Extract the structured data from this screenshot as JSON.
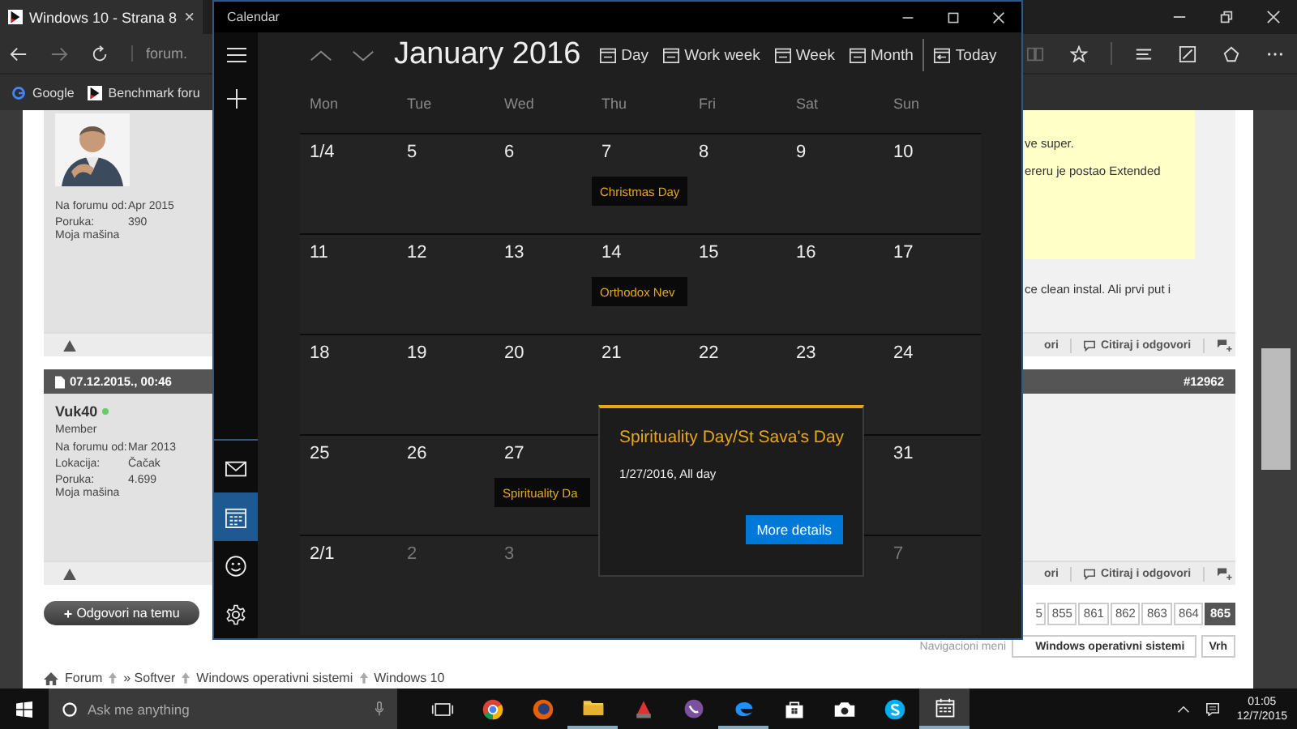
{
  "browser": {
    "tab_title": "Windows 10 - Strana 8",
    "tab_close": "×",
    "address": "forum.",
    "favorites": [
      {
        "kind": "google",
        "label": "Google"
      },
      {
        "kind": "site",
        "label": "Benchmark foru"
      }
    ]
  },
  "forum": {
    "post1": {
      "stats": [
        {
          "label": "Na forumu od:",
          "value": "Apr 2015"
        },
        {
          "label": "Poruka:",
          "value": "390"
        }
      ],
      "machine": "Moja mašina",
      "quote_lines": [
        "ve super.",
        "ereru je postao Extended"
      ],
      "text": "ce clean instal. Ali prvi put i",
      "actions": [
        "ori",
        "Citiraj i odgovori"
      ]
    },
    "post2": {
      "date": "07.12.2015., 00:46",
      "number": "#12962",
      "user": "Vuk40",
      "online": true,
      "rank": "Member",
      "stats": [
        {
          "label": "Na forumu od:",
          "value": "Mar 2013"
        },
        {
          "label": "Lokacija:",
          "value": "Čačak"
        },
        {
          "label": "Poruka:",
          "value": "4.699"
        }
      ],
      "machine": "Moja mašina",
      "actions": [
        "ori",
        "Citiraj i odgovori"
      ]
    },
    "reply_button": "Odgovori na temu",
    "pages": [
      {
        "label": "5",
        "selected": false
      },
      {
        "label": "855",
        "selected": false
      },
      {
        "label": "861",
        "selected": false
      },
      {
        "label": "862",
        "selected": false
      },
      {
        "label": "863",
        "selected": false
      },
      {
        "label": "864",
        "selected": false
      },
      {
        "label": "865",
        "selected": true
      }
    ],
    "nav_label": "Navigacioni meni",
    "nav_select": "Windows operativni sistemi",
    "top_button": "Vrh",
    "breadcrumbs": [
      "Forum",
      "» Softver",
      "Windows operativni sistemi",
      "Windows 10"
    ]
  },
  "calendar": {
    "title": "Calendar",
    "month": "January 2016",
    "views": [
      "Day",
      "Work week",
      "Week",
      "Month"
    ],
    "today": "Today",
    "rail": [
      {
        "kind": "mail",
        "selected": false
      },
      {
        "kind": "calendar",
        "selected": true
      },
      {
        "kind": "smiley",
        "selected": false
      },
      {
        "kind": "gear",
        "selected": false
      }
    ],
    "weekdays": [
      "Mon",
      "Tue",
      "Wed",
      "Thu",
      "Fri",
      "Sat",
      "Sun"
    ],
    "weeks": [
      [
        {
          "day": "1/4",
          "muted": false
        },
        {
          "day": "5",
          "muted": false
        },
        {
          "day": "6",
          "muted": false
        },
        {
          "day": "7",
          "muted": false,
          "event": "Christmas Day"
        },
        {
          "day": "8",
          "muted": false
        },
        {
          "day": "9",
          "muted": false
        },
        {
          "day": "10",
          "muted": false
        }
      ],
      [
        {
          "day": "11",
          "muted": false
        },
        {
          "day": "12",
          "muted": false
        },
        {
          "day": "13",
          "muted": false
        },
        {
          "day": "14",
          "muted": false,
          "event": "Orthodox Nev"
        },
        {
          "day": "15",
          "muted": false
        },
        {
          "day": "16",
          "muted": false
        },
        {
          "day": "17",
          "muted": false
        }
      ],
      [
        {
          "day": "18",
          "muted": false
        },
        {
          "day": "19",
          "muted": false
        },
        {
          "day": "20",
          "muted": false
        },
        {
          "day": "21",
          "muted": false
        },
        {
          "day": "22",
          "muted": false
        },
        {
          "day": "23",
          "muted": false
        },
        {
          "day": "24",
          "muted": false
        }
      ],
      [
        {
          "day": "25",
          "muted": false
        },
        {
          "day": "26",
          "muted": false
        },
        {
          "day": "27",
          "muted": false,
          "event": "Spirituality Da"
        },
        {
          "day": "31",
          "muted": false
        }
      ],
      [
        {
          "day": "2/1",
          "muted": false
        },
        {
          "day": "2",
          "muted": true
        },
        {
          "day": "3",
          "muted": true
        },
        {
          "day": "7",
          "muted": true
        }
      ]
    ],
    "popup": {
      "title": "Spirituality Day/St Sava's Day",
      "when": "1/27/2016, All day",
      "button": "More details"
    }
  },
  "taskbar": {
    "search_placeholder": "Ask me anything",
    "apps": [
      {
        "kind": "taskview",
        "running": false,
        "selected": false
      },
      {
        "kind": "chrome",
        "running": false,
        "selected": false
      },
      {
        "kind": "firefox",
        "running": false,
        "selected": false
      },
      {
        "kind": "explorer",
        "running": true,
        "selected": false
      },
      {
        "kind": "ccleaner",
        "running": false,
        "selected": false
      },
      {
        "kind": "viber",
        "running": false,
        "selected": false
      },
      {
        "kind": "edge",
        "running": true,
        "selected": false
      },
      {
        "kind": "store",
        "running": false,
        "selected": false
      },
      {
        "kind": "camera",
        "running": false,
        "selected": false
      },
      {
        "kind": "skype",
        "running": false,
        "selected": false
      },
      {
        "kind": "calendar",
        "running": true,
        "selected": true
      }
    ],
    "time": "01:05",
    "date": "12/7/2015"
  }
}
